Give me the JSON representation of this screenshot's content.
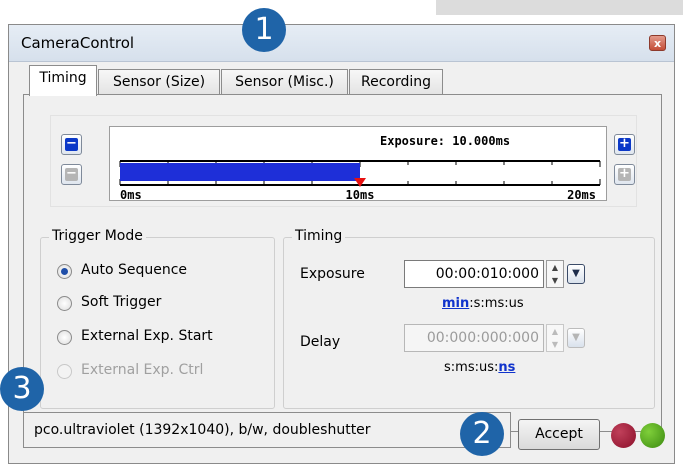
{
  "window": {
    "title": "CameraControl",
    "close_glyph": "x"
  },
  "tabs": [
    {
      "label": "Timing",
      "active": true
    },
    {
      "label": "Sensor (Size)",
      "active": false
    },
    {
      "label": "Sensor (Misc.)",
      "active": false
    },
    {
      "label": "Recording",
      "active": false
    }
  ],
  "exposure_slider": {
    "label": "Exposure: 10.000ms",
    "value_ms": 10,
    "range_ms": [
      0,
      20
    ],
    "ticks": [
      "0ms",
      "10ms",
      "20ms"
    ],
    "bar_color": "#1e2fd8",
    "marker_color": "#e81010"
  },
  "trigger_mode": {
    "title": "Trigger Mode",
    "options": [
      {
        "label": "Auto Sequence",
        "checked": true,
        "enabled": true
      },
      {
        "label": "Soft Trigger",
        "checked": false,
        "enabled": true
      },
      {
        "label": "External Exp. Start",
        "checked": false,
        "enabled": true
      },
      {
        "label": "External Exp. Ctrl",
        "checked": false,
        "enabled": false
      }
    ]
  },
  "timing": {
    "title": "Timing",
    "exposure": {
      "label": "Exposure",
      "value": "00:00:010:000",
      "unit_link": "min",
      "unit_rest": ":s:ms:us"
    },
    "delay": {
      "label": "Delay",
      "value": "00:000:000:000",
      "unit_rest": "s:ms:us:",
      "unit_link": "ns"
    }
  },
  "status": {
    "text": "pco.ultraviolet (1392x1040), b/w, doubleshutter"
  },
  "accept_label": "Accept",
  "leds": {
    "red": "#8b0f2a",
    "green": "#3b8a10"
  },
  "callouts": [
    "1",
    "2",
    "3"
  ],
  "accent_color": "#1f64a8"
}
